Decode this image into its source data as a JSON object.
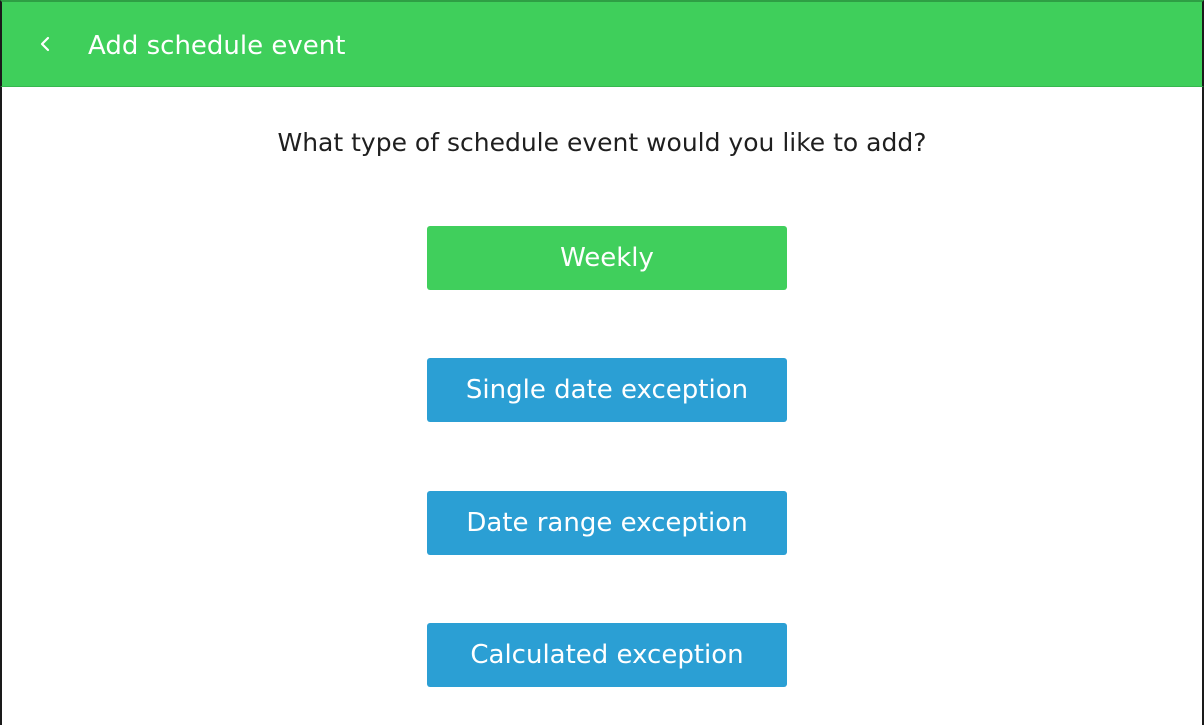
{
  "header": {
    "title": "Add schedule event",
    "back_icon": "chevron-left-icon",
    "background_color": "#3fcf5b"
  },
  "prompt": {
    "question": "What type of schedule event would you like to add?"
  },
  "options": [
    {
      "label": "Weekly",
      "color": "#40cf5c"
    },
    {
      "label": "Single date exception",
      "color": "#2b9fd4"
    },
    {
      "label": "Date range exception",
      "color": "#2b9fd4"
    },
    {
      "label": "Calculated exception",
      "color": "#2b9fd4"
    }
  ]
}
